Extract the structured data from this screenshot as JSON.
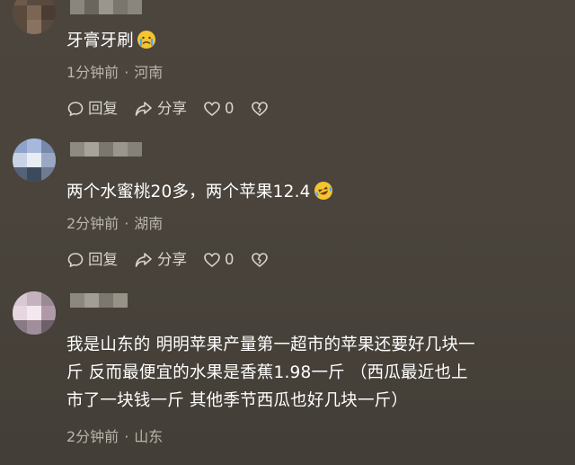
{
  "comments": [
    {
      "text": "牙膏牙刷",
      "emoji_icon": "crying-face-icon",
      "time": "1分钟前",
      "location": "河南",
      "reply_label": "回复",
      "share_label": "分享",
      "like_count": "0"
    },
    {
      "text": "两个水蜜桃20多，两个苹果12.4",
      "emoji_icon": "laughing-crying-face-icon",
      "time": "2分钟前",
      "location": "湖南",
      "reply_label": "回复",
      "share_label": "分享",
      "like_count": "0"
    },
    {
      "text_lines": [
        "我是山东的 明明苹果产量第一超市的苹果还要好几块一",
        "斤 反而最便宜的水果是香蕉1.98一斤 （西瓜最近也上",
        "市了一块钱一斤 其他季节西瓜也好几块一斤）"
      ],
      "time": "2分钟前",
      "location": "山东"
    }
  ],
  "meta_separator": "·",
  "colors": {
    "background": "#48423a",
    "meta_text": "#b9b4ac",
    "action_text": "#d9d5cf"
  }
}
